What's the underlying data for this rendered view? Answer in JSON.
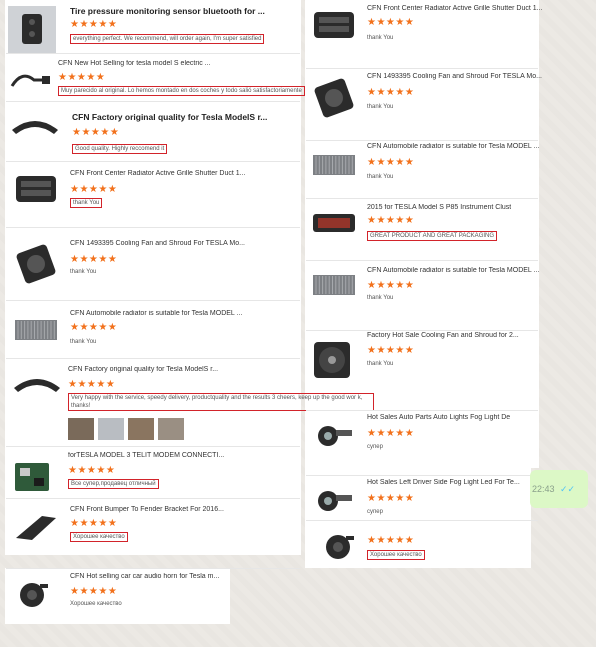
{
  "left": [
    {
      "title": "Tire pressure monitoring sensor bluetooth for ...",
      "big": true,
      "stars": "★★★★★",
      "review": "everything perfect. We recommend, will order again, I'm super satisfied",
      "box": true,
      "icon": "tpms-sensor-icon"
    },
    {
      "title": "CFN New Hot Selling for tesla model S electric ...",
      "big": false,
      "stars": "★★★★★",
      "review": "Muy parecido al original. Lo hemos montado en dos coches y todo salió satisfactoriamente",
      "box": true,
      "icon": "charge-cable-icon"
    },
    {
      "title": "CFN Factory original quality for Tesla ModelS r...",
      "big": true,
      "stars": "★★★★★",
      "review": "Good quality. Highly reccomend it",
      "box": true,
      "icon": "trim-strip-icon"
    },
    {
      "title": "CFN Front Center Radiator Active Grille Shutter Duct 1...",
      "big": false,
      "stars": "★★★★★",
      "review": "thank You",
      "box": true,
      "icon": "grille-shutter-icon"
    },
    {
      "title": "CFN 1493395 Cooling Fan and Shroud For TESLA Mo...",
      "big": false,
      "stars": "★★★★★",
      "review": "thank You",
      "box": false,
      "icon": "fan-shroud-icon"
    },
    {
      "title": "CFN Automobile radiator is suitable for Tesla MODEL ...",
      "big": false,
      "stars": "★★★★★",
      "review": "thank You",
      "box": false,
      "icon": "radiator-icon"
    },
    {
      "title": "CFN Factory original quality for Tesla ModelS r...",
      "big": false,
      "stars": "★★★★★",
      "review": "Very happy with the service, speedy delivery, productquality and the results 3 cheers, keep up the good wor k, thanks!",
      "box": true,
      "icon": "trim-strip-icon"
    },
    {
      "title": "forTESLA MODEL 3 TELIT MODEM CONNECTI...",
      "big": false,
      "stars": "★★★★★",
      "review": "Все супер,продавец отличный",
      "box": true,
      "icon": "modem-board-icon"
    },
    {
      "title": "CFN Front Bumper To Fender Bracket For 2016...",
      "big": false,
      "stars": "★★★★★",
      "review": "Хорошее качество",
      "box": true,
      "icon": "bumper-bracket-icon"
    },
    {
      "title": "CFN Hot selling car car audio horn for Tesla m...",
      "big": false,
      "stars": "★★★★★",
      "review": "Хорошее качество",
      "box": false,
      "icon": "audio-horn-icon"
    }
  ],
  "right": [
    {
      "title": "CFN Front Center Radiator Active Grille Shutter Duct 1...",
      "big": false,
      "stars": "★★★★★",
      "review": "thank You",
      "box": false,
      "icon": "grille-shutter-icon"
    },
    {
      "title": "CFN 1493395 Cooling Fan and Shroud For TESLA Mo...",
      "big": false,
      "stars": "★★★★★",
      "review": "thank You",
      "box": false,
      "icon": "fan-shroud-icon"
    },
    {
      "title": "CFN Automobile radiator is suitable for Tesla MODEL ...",
      "big": false,
      "stars": "★★★★★",
      "review": "thank You",
      "box": false,
      "icon": "radiator-icon"
    },
    {
      "title": "2015 for TESLA Model S P85 Instrument Clust",
      "big": false,
      "stars": "★★★★★",
      "review": "GREAT PRODUCT AND GREAT PACKAGING",
      "box": true,
      "icon": "instrument-cluster-icon"
    },
    {
      "title": "CFN Automobile radiator is suitable for Tesla MODEL ...",
      "big": false,
      "stars": "★★★★★",
      "review": "thank You",
      "box": false,
      "icon": "radiator-icon"
    },
    {
      "title": "Factory Hot Sale Cooling Fan and Shroud for 2...",
      "big": false,
      "stars": "★★★★★",
      "review": "thank You",
      "box": false,
      "icon": "cooling-fan-icon"
    },
    {
      "title": "Hot Sales Auto Parts Auto Lights Fog Light De",
      "big": false,
      "stars": "★★★★★",
      "review": "супер",
      "box": false,
      "icon": "fog-light-icon"
    },
    {
      "title": "Hot Sales Left Driver Side Fog Light Led For Te...",
      "big": false,
      "stars": "★★★★★",
      "review": "супер",
      "box": false,
      "icon": "fog-light-icon"
    },
    {
      "title": "",
      "big": false,
      "stars": "★★★★★",
      "review": "Хорошее качество",
      "box": true,
      "icon": "audio-horn-icon"
    }
  ],
  "chat": {
    "time": "22:43",
    "ticks": "✓✓"
  },
  "colors": {
    "star": "#f2711c",
    "highlight_box": "#d2232a",
    "bubble": "#dcf8c6"
  }
}
